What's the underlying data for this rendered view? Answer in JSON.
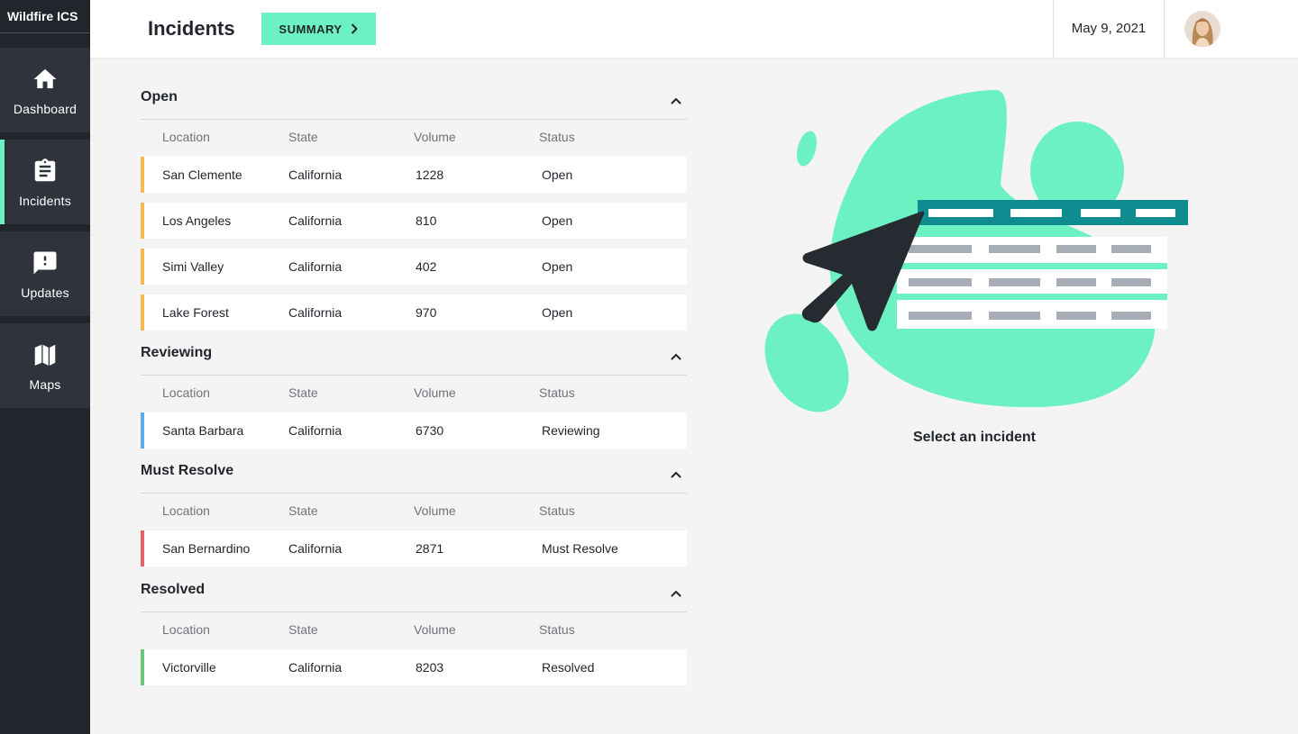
{
  "app": {
    "name": "Wildfire ICS"
  },
  "sidebar": {
    "items": [
      {
        "label": "Dashboard",
        "icon": "home-icon",
        "active": false
      },
      {
        "label": "Incidents",
        "icon": "clipboard-icon",
        "active": true
      },
      {
        "label": "Updates",
        "icon": "alert-message-icon",
        "active": false
      },
      {
        "label": "Maps",
        "icon": "map-icon",
        "active": false
      }
    ]
  },
  "header": {
    "title": "Incidents",
    "summary_label": "SUMMARY",
    "date": "May 9, 2021"
  },
  "table_columns": [
    "Location",
    "State",
    "Volume",
    "Status"
  ],
  "groups": [
    {
      "title": "Open",
      "color": "#f7b955",
      "rows": [
        {
          "location": "San Clemente",
          "state": "California",
          "volume": "1228",
          "status": "Open"
        },
        {
          "location": "Los Angeles",
          "state": "California",
          "volume": "810",
          "status": "Open"
        },
        {
          "location": "Simi Valley",
          "state": "California",
          "volume": "402",
          "status": "Open"
        },
        {
          "location": "Lake Forest",
          "state": "California",
          "volume": "970",
          "status": "Open"
        }
      ]
    },
    {
      "title": "Reviewing",
      "color": "#5aaeea",
      "rows": [
        {
          "location": "Santa Barbara",
          "state": "California",
          "volume": "6730",
          "status": "Reviewing"
        }
      ]
    },
    {
      "title": "Must Resolve",
      "color": "#e2636b",
      "rows": [
        {
          "location": "San Bernardino",
          "state": "California",
          "volume": "2871",
          "status": "Must Resolve"
        }
      ]
    },
    {
      "title": "Resolved",
      "color": "#6cc77a",
      "rows": [
        {
          "location": "Victorville",
          "state": "California",
          "volume": "8203",
          "status": "Resolved"
        }
      ]
    }
  ],
  "empty_state": {
    "text": "Select an incident"
  },
  "colors": {
    "accent": "#6cf2c2",
    "sidebar": "#21252c",
    "sidebar_item": "#2f333b",
    "teal": "#0f8c8f"
  }
}
